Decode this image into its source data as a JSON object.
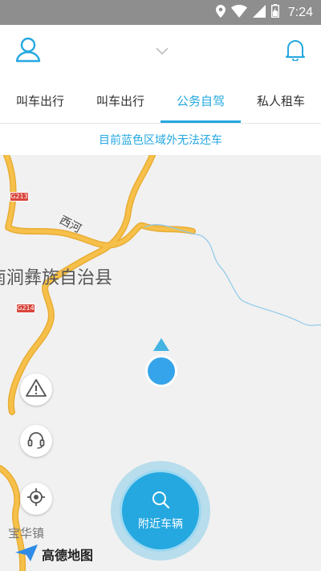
{
  "status_bar": {
    "time": "7:24",
    "icons": [
      "location-icon",
      "wifi-icon",
      "signal-icon",
      "battery-icon"
    ]
  },
  "header": {
    "profile_icon": "user-icon",
    "dropdown_icon": "chevron-down-icon",
    "bell_icon": "bell-icon"
  },
  "tabs": [
    {
      "label": "叫车出行",
      "active": false
    },
    {
      "label": "叫车出行",
      "active": false
    },
    {
      "label": "公务自驾",
      "active": true
    },
    {
      "label": "私人租车",
      "active": false
    }
  ],
  "notice": "目前蓝色区域外无法还车",
  "map": {
    "labels": {
      "county": "南涧彝族自治县",
      "river": "西河",
      "town": "宝华镇"
    },
    "road_shields": [
      "G213",
      "G214"
    ],
    "logo_text": "高德地图"
  },
  "controls": {
    "report_icon": "warning-icon",
    "service_icon": "headset-icon",
    "locate_icon": "locate-icon"
  },
  "nearby_button": {
    "label": "附近车辆",
    "icon": "search-icon"
  },
  "colors": {
    "accent": "#25a8e0",
    "road": "#f6c04a",
    "status_bar": "#8e8e8e",
    "map_bg": "#f1f1f1"
  }
}
